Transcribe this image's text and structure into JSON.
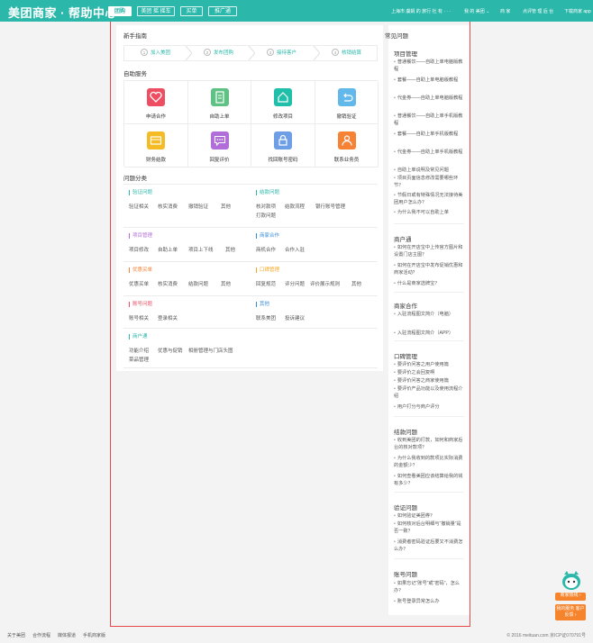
{
  "header": {
    "logo": "美团商家 · 帮助中心",
    "nav": [
      "团购",
      "美团 摇 摇车",
      "买单",
      "推广通"
    ],
    "links": [
      "上海市 虞娟 的 旅行 社 有 · · ·",
      "我 的 美团 ⌄",
      "商 家",
      "点评管 理 后 台",
      "下载商家 app"
    ]
  },
  "guide": {
    "title": "新手指南",
    "steps": [
      {
        "num": "1",
        "label": "加入美团"
      },
      {
        "num": "2",
        "label": "发布团购"
      },
      {
        "num": "3",
        "label": "接待客户"
      },
      {
        "num": "4",
        "label": "核销结算"
      }
    ]
  },
  "services": {
    "title": "自助服务",
    "items": [
      {
        "label": "申请合作",
        "icon": "handshake-icon",
        "color": "#ee4e62"
      },
      {
        "label": "自助上单",
        "icon": "document-icon",
        "color": "#5fc284"
      },
      {
        "label": "修改项目",
        "icon": "house-icon",
        "color": "#1fbfaa"
      },
      {
        "label": "撤销验证",
        "icon": "undo-icon",
        "color": "#62b8ea"
      },
      {
        "label": "财务结款",
        "icon": "card-icon",
        "color": "#f5bb25"
      },
      {
        "label": "回复评价",
        "icon": "chat-icon",
        "color": "#b26ed8"
      },
      {
        "label": "找回账号密码",
        "icon": "lock-icon",
        "color": "#6e9fe6"
      },
      {
        "label": "联系业务员",
        "icon": "person-icon",
        "color": "#f58235"
      }
    ]
  },
  "categories": {
    "title": "问题分类",
    "groups": [
      {
        "title": "验证问题",
        "color": "#2bb8aa",
        "links": [
          "验证相关",
          "核实消费",
          "撤销验证",
          "其他"
        ]
      },
      {
        "title": "结款问题",
        "color": "#2bb8aa",
        "links": [
          "核对款项",
          "结款流程",
          "银行账号管理",
          "打款问题"
        ]
      },
      {
        "title": "项目管理",
        "color": "#b26ed8",
        "links": [
          "项目修改",
          "自助上单",
          "项目上下线",
          "其他"
        ]
      },
      {
        "title": "商家合作",
        "color": "#3c8dd8",
        "links": [
          "商机合作",
          "合作入驻"
        ]
      },
      {
        "title": "优惠买单",
        "color": "#f58235",
        "links": [
          "优惠买单",
          "核实消费",
          "结款问题",
          "其他"
        ]
      },
      {
        "title": "口碑管理",
        "color": "#f5a623",
        "links": [
          "回复规范",
          "评分问题",
          "评价展示规则",
          "其他"
        ]
      },
      {
        "title": "账号问题",
        "color": "#ee4e62",
        "links": [
          "账号相关",
          "登录相关"
        ]
      },
      {
        "title": "其他",
        "color": "#3c8dd8",
        "links": [
          "联系美团",
          "投诉建议"
        ]
      },
      {
        "title": "商户通",
        "color": "#2bb8aa",
        "links": [
          "功能介绍",
          "优惠与促销",
          "相册管理与门店头图",
          "菜品管理"
        ]
      }
    ]
  },
  "faq": {
    "title": "常见问题",
    "sections": [
      {
        "title": "项目管理",
        "items": [
          "普通餐饮——自助上单电脑版教程",
          "套餐——自助上单电脑版教程",
          "代金券——自助上单电脑版教程",
          "普通餐饮——自助上单手机版教程",
          "套餐——自助上单手机版教程",
          "代金券——自助上单手机版教程",
          "自助上单说明及常见问题",
          "项目页面信息修改需要哪些环节？",
          "节假日或有特殊情况无法接待美团用户怎么办？",
          "为什么我不可以自助上单"
        ]
      },
      {
        "title": "商户通",
        "items": [
          "如何在开店宝中上传官方图片和设置门店主图？",
          "如何在开店宝中发布促销优惠和商家活动？",
          "什么是商家选牌宝？"
        ]
      },
      {
        "title": "商家合作",
        "items": [
          "入驻流程图文简介（电脑）",
          "入驻流程图文简介（APP）"
        ]
      },
      {
        "title": "口碑管理",
        "items": [
          "要评价问答之用户使用篇",
          "要评价之会回复啊",
          "要评价问答之商家使用篇",
          "要评价产品功能以及使用流程介绍",
          "用户打分与商户评分"
        ]
      },
      {
        "title": "结款问题",
        "items": [
          "收到美团的打款，如何和商家后台的核对款项？",
          "为什么我收到的款项比实际消费的金额少？",
          "如何查看美团应该结算给我的钱有多少？"
        ]
      },
      {
        "title": "验证问题",
        "items": [
          "如何验证美团券？",
          "如何核对后台明细与“撤销量”是否一致？",
          "消费者密码验证后要又不消费怎么办？"
        ]
      },
      {
        "title": "账号问题",
        "items": [
          "如果忘记“账号”或“密码”，怎么办？",
          "账号登录异常怎么办"
        ]
      }
    ]
  },
  "footer": {
    "links": [
      "关于美团",
      "合作流程",
      "媒体报道",
      "手机商家版"
    ],
    "copyright": "© 2016 meituan.com 京ICP证070791号"
  },
  "float": {
    "buttons": [
      "商家热线 ›",
      "我的服务 客户反馈 ›"
    ]
  }
}
